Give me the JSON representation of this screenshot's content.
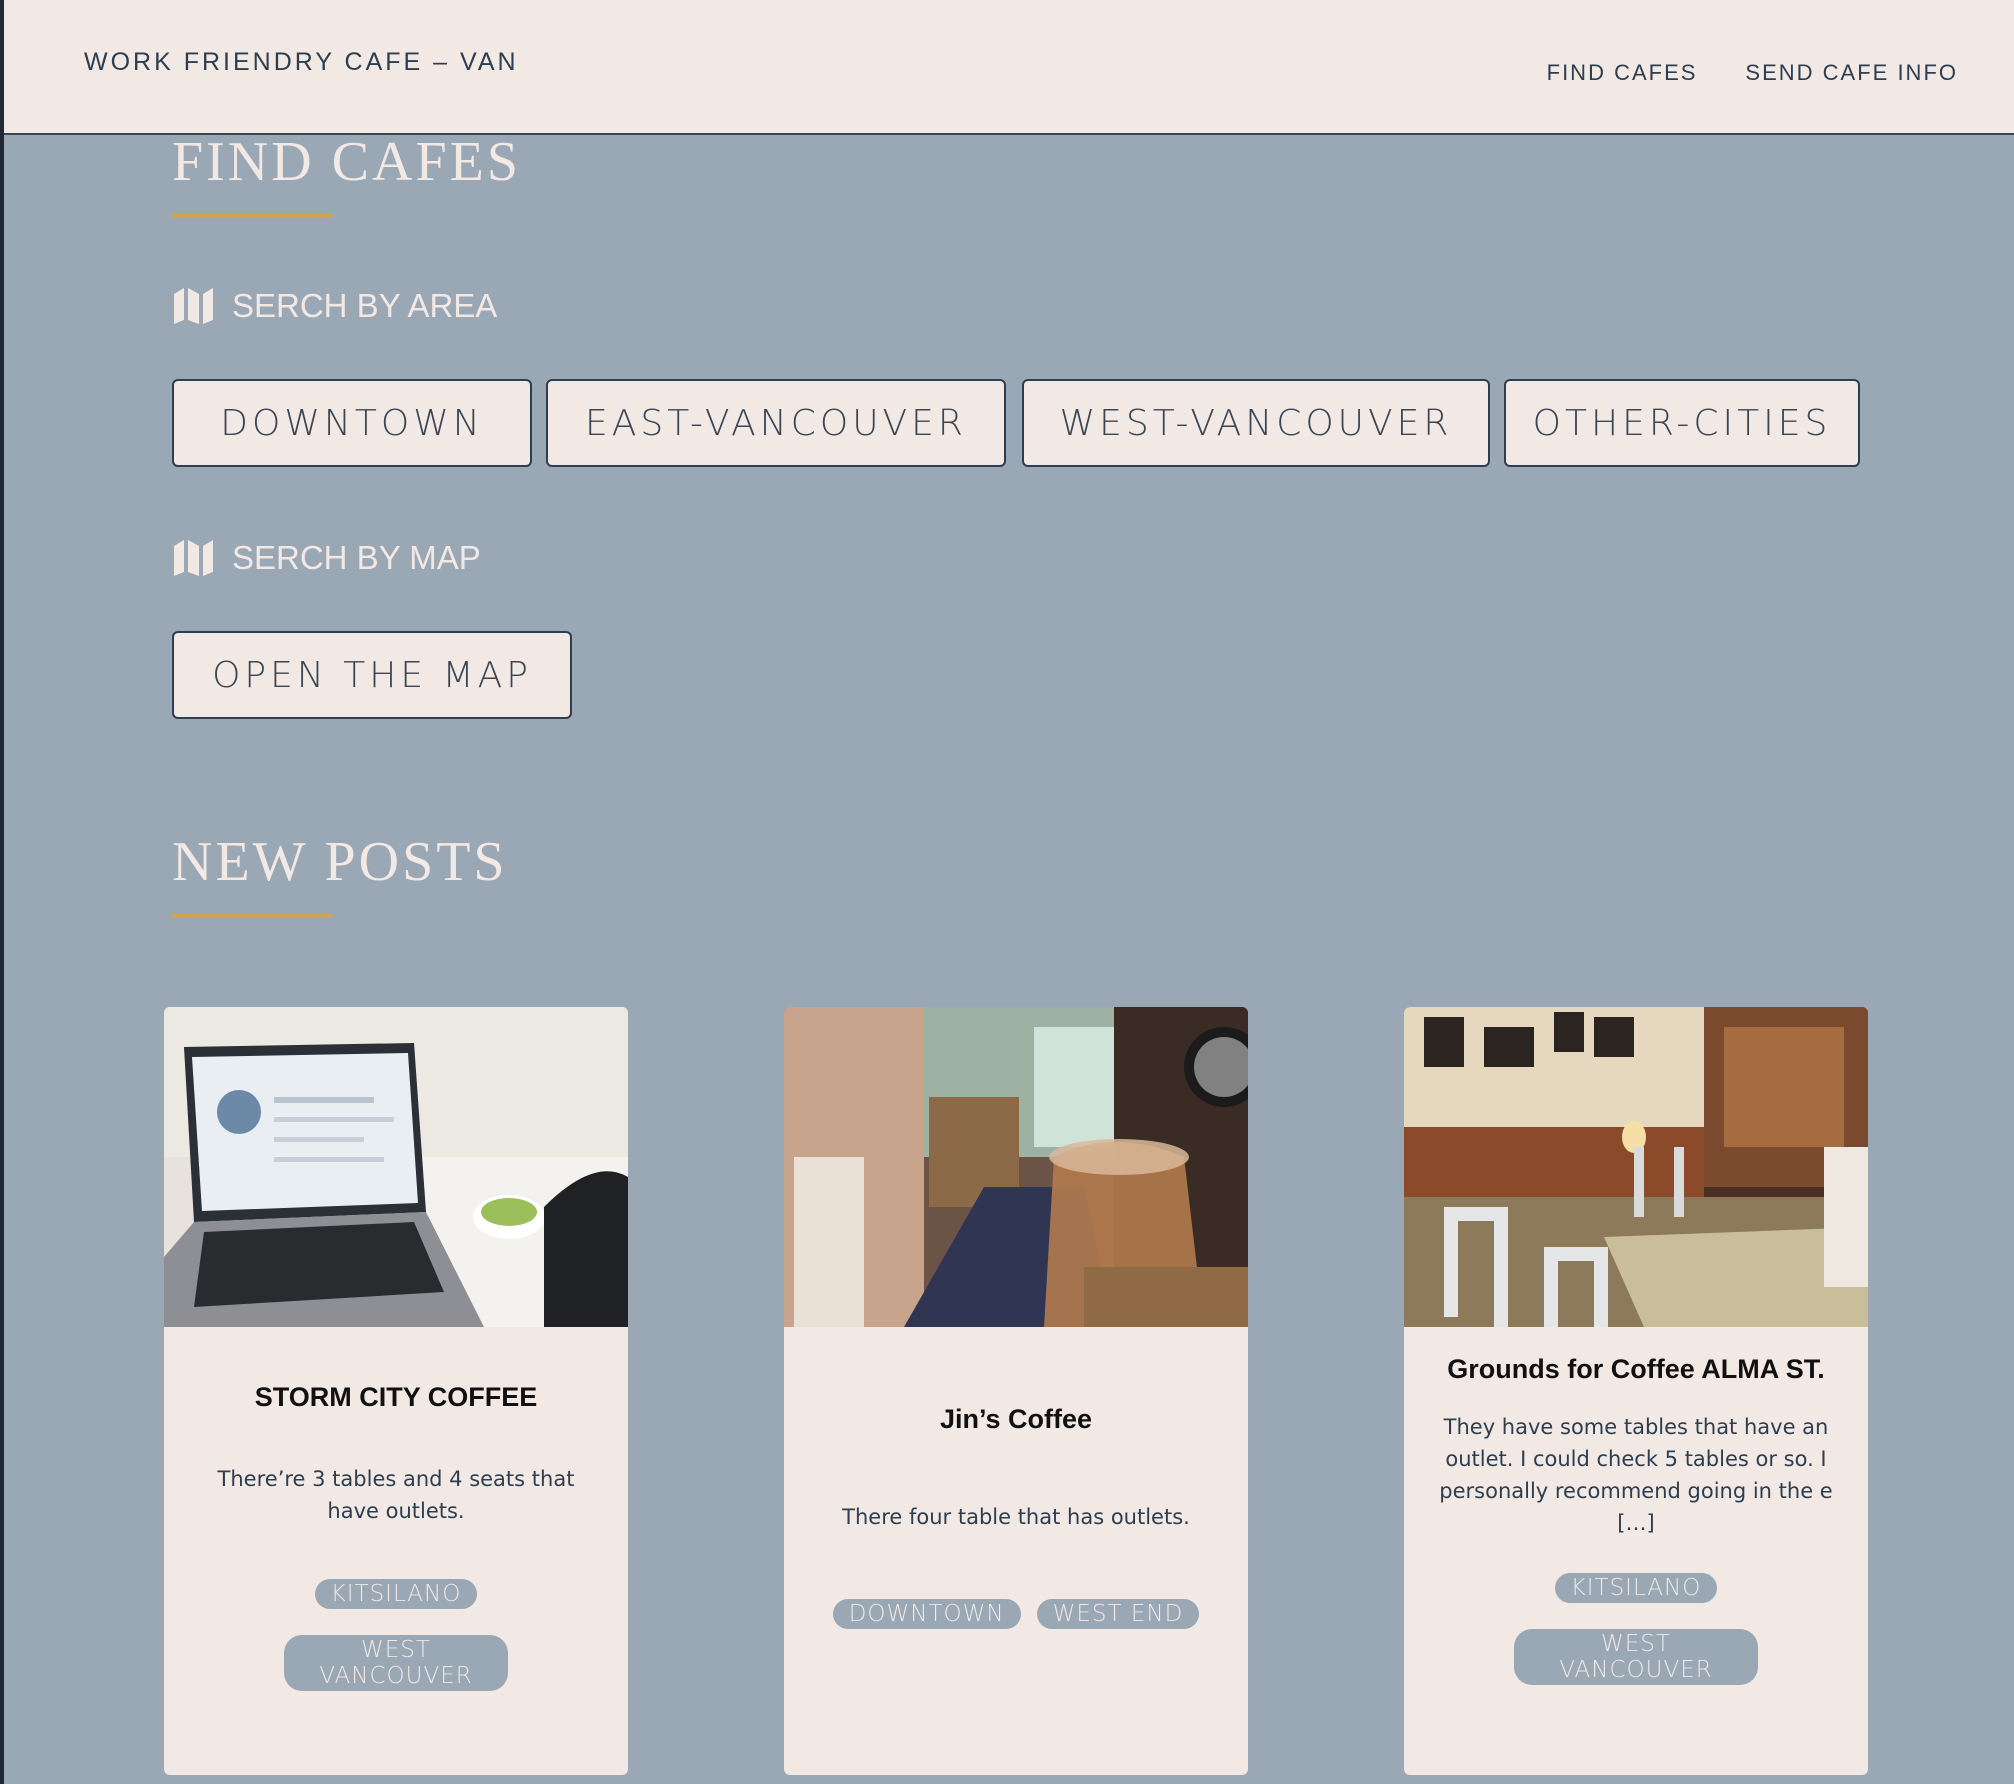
{
  "header": {
    "site_title": "WORK FRIENDRY CAFE – VAN",
    "nav": [
      "FIND CAFES",
      "SEND CAFE INFO"
    ]
  },
  "find_cafes": {
    "title": "FIND CAFES",
    "area_heading": "SERCH BY AREA",
    "areas": [
      "DOWNTOWN",
      "EAST-VANCOUVER",
      "WEST-VANCOUVER",
      "OTHER-CITIES"
    ],
    "map_heading": "SERCH BY MAP",
    "map_button": "OPEN THE MAP"
  },
  "new_posts": {
    "title": "NEW POSTS",
    "cards": [
      {
        "title": "STORM CITY COFFEE",
        "text": "There’re 3 tables and 4 seats that have outlets.",
        "tags": [
          "KITSILANO",
          "WEST VANCOUVER"
        ]
      },
      {
        "title": "Jin’s Coffee",
        "text": "There four table that has outlets.",
        "tags": [
          "DOWNTOWN",
          "WEST END"
        ]
      },
      {
        "title": "Grounds for Coffee ALMA ST.",
        "text": "They have some tables that have an outlet. I could check 5 tables or so. I personally recommend going in the e […]",
        "tags": [
          "KITSILANO",
          "WEST VANCOUVER"
        ]
      }
    ]
  },
  "colors": {
    "background": "#9aa8b5",
    "panel": "#f2e8e4",
    "accent": "#d4a24c",
    "text": "#2c3e50"
  },
  "icons": [
    "map-icon"
  ]
}
